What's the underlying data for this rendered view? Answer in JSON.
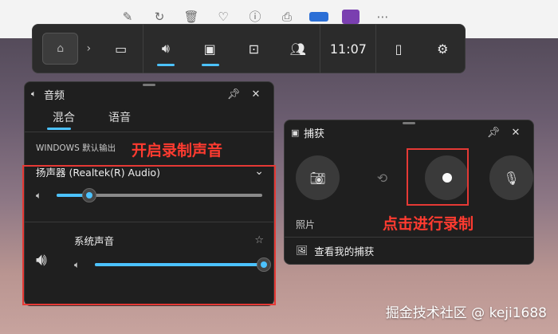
{
  "top_strip": {
    "icons": [
      "edit-icon",
      "rotate-icon",
      "delete-icon",
      "heart-icon",
      "info-icon",
      "print-icon",
      "onedrive-icon",
      "app-icon",
      "more-icon"
    ]
  },
  "gamebar": {
    "time": "11:07",
    "buttons": [
      "widget-layout-icon",
      "audio-icon",
      "capture-icon",
      "performance-icon",
      "social-icon"
    ]
  },
  "audio_panel": {
    "title": "音频",
    "tabs": [
      {
        "label": "混合"
      },
      {
        "label": "语音"
      }
    ],
    "output_label": "WINDOWS 默认输出",
    "device_name": "扬声器 (Realtek(R) Audio)",
    "device_volume": 0.16,
    "app_name": "系统声音",
    "app_volume": 1.0
  },
  "capture_panel": {
    "title": "捕获",
    "screenshot_label": "照片",
    "gallery_link": "查看我的捕获"
  },
  "annotations": {
    "enable_audio": "开启录制声音",
    "click_record": "点击进行录制"
  },
  "watermark": "掘金技术社区 @ keji1688",
  "colors": {
    "accent": "#4cc2ff",
    "annotation": "#e53935"
  }
}
